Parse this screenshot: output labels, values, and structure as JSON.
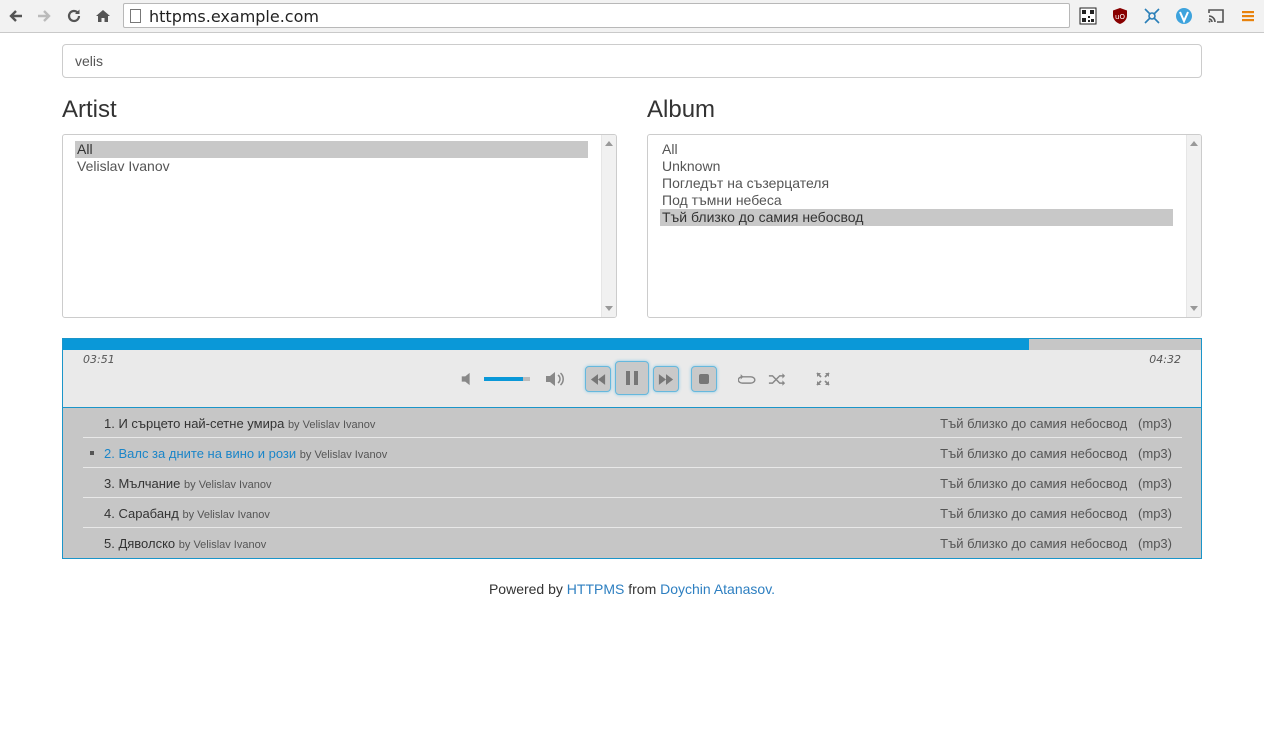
{
  "browser": {
    "url": "httpms.example.com"
  },
  "search": {
    "value": "velis"
  },
  "artist": {
    "title": "Artist",
    "options": [
      "All",
      "Velislav Ivanov"
    ],
    "selected_index": 0
  },
  "album": {
    "title": "Album",
    "options": [
      "All",
      "Unknown",
      "Погледът на съзерцателя",
      "Под тъмни небеса",
      "Тъй близко до самия небосвод"
    ],
    "selected_index": 4
  },
  "player": {
    "elapsed": "03:51",
    "duration": "04:32",
    "progress_fraction": 0.849,
    "volume_fraction": 0.85,
    "accent_color": "#0a98d8"
  },
  "playlist": [
    {
      "title": "1. И сърцето най-сетне умира",
      "by": "by Velislav Ivanov",
      "album": "Тъй близко до самия небосвод",
      "format": "(mp3)",
      "active": false
    },
    {
      "title": "2. Валс за дните на вино и рози",
      "by": "by Velislav Ivanov",
      "album": "Тъй близко до самия небосвод",
      "format": "(mp3)",
      "active": true
    },
    {
      "title": "3. Мълчание",
      "by": "by Velislav Ivanov",
      "album": "Тъй близко до самия небосвод",
      "format": "(mp3)",
      "active": false
    },
    {
      "title": "4. Сарабанд",
      "by": "by Velislav Ivanov",
      "album": "Тъй близко до самия небосвод",
      "format": "(mp3)",
      "active": false
    },
    {
      "title": "5. Дяволско",
      "by": "by Velislav Ivanov",
      "album": "Тъй близко до самия небосвод",
      "format": "(mp3)",
      "active": false
    }
  ],
  "footer": {
    "prefix": "Powered by",
    "link1": "HTTPMS",
    "middle": "from",
    "link2": "Doychin Atanasov."
  }
}
